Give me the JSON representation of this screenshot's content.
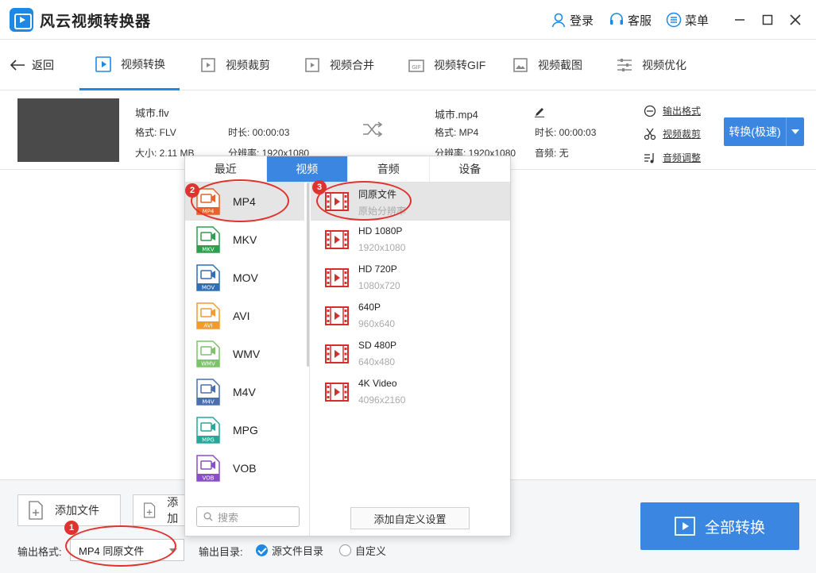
{
  "app": {
    "title": "风云视频转换器"
  },
  "titlebar": {
    "login": "登录",
    "service": "客服",
    "menu": "菜单",
    "minimize": "—",
    "maximize": "□",
    "close": "✕"
  },
  "tabbar": {
    "back": "返回",
    "tabs": [
      {
        "label": "视频转换",
        "active": true
      },
      {
        "label": "视频裁剪"
      },
      {
        "label": "视频合并"
      },
      {
        "label": "视频转GIF"
      },
      {
        "label": "视频截图"
      },
      {
        "label": "视频优化"
      }
    ]
  },
  "file": {
    "source_name": "城市.flv",
    "source_format": "格式: FLV",
    "source_size": "大小: 2.11 MB",
    "source_duration": "时长: 00:00:03",
    "source_resolution": "分辨率: 1920x1080",
    "target_name": "城市.mp4",
    "target_format": "格式: MP4",
    "target_resolution": "分辨率: 1920x1080",
    "target_duration": "时长: 00:00:03",
    "target_audio": "音频: 无",
    "links": {
      "output_format": "输出格式",
      "video_crop": "视频裁剪",
      "audio_adjust": "音频调整"
    },
    "convert_button": "转换(极速)"
  },
  "popup": {
    "tabs": [
      {
        "label": "最近"
      },
      {
        "label": "视频",
        "active": true
      },
      {
        "label": "音频"
      },
      {
        "label": "设备"
      }
    ],
    "formats": [
      {
        "label": "MP4",
        "tag": "MP4",
        "color": "#e8622a",
        "selected": true
      },
      {
        "label": "MKV",
        "tag": "MKV",
        "color": "#2e9e4f"
      },
      {
        "label": "MOV",
        "tag": "MOV",
        "color": "#2f6fb8"
      },
      {
        "label": "AVI",
        "tag": "AVI",
        "color": "#f39a2e"
      },
      {
        "label": "WMV",
        "tag": "WMV",
        "color": "#7cc36a"
      },
      {
        "label": "M4V",
        "tag": "M4V",
        "color": "#4a6fb0"
      },
      {
        "label": "MPG",
        "tag": "MPG",
        "color": "#27a89a"
      },
      {
        "label": "VOB",
        "tag": "VOB",
        "color": "#8a4fc8"
      }
    ],
    "search_placeholder": "搜索",
    "resolutions": [
      {
        "name": "同原文件",
        "sub": "原始分辨率",
        "selected": true
      },
      {
        "name": "HD 1080P",
        "sub": "1920x1080"
      },
      {
        "name": "HD 720P",
        "sub": "1080x720"
      },
      {
        "name": "640P",
        "sub": "960x640"
      },
      {
        "name": "SD 480P",
        "sub": "640x480"
      },
      {
        "name": "4K Video",
        "sub": "4096x2160"
      }
    ],
    "custom_button": "添加自定义设置"
  },
  "bottom": {
    "add_file": "添加文件",
    "add_folder": "添加",
    "output_format_label": "输出格式:",
    "output_format_value": "MP4 同原文件",
    "output_dir_label": "输出目录:",
    "dir_source": "源文件目录",
    "dir_custom": "自定义",
    "convert_all": "全部转换"
  },
  "annotations": {
    "step1": "1",
    "step2": "2",
    "step3": "3"
  }
}
